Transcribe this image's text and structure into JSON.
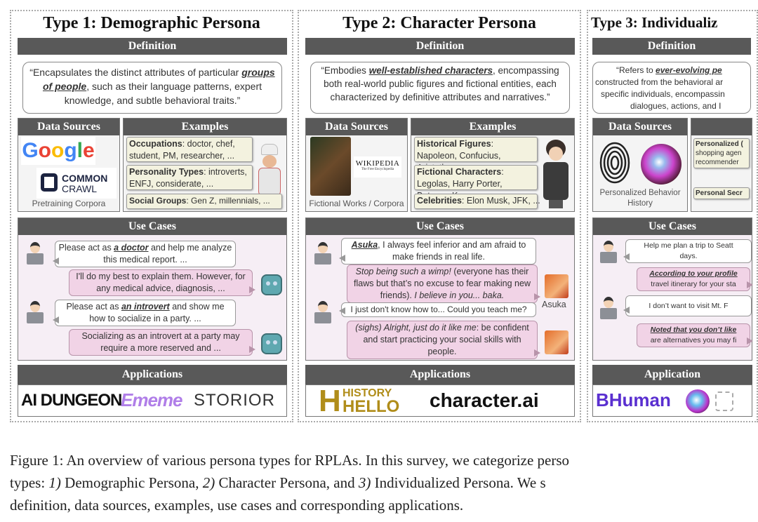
{
  "panels": [
    {
      "title": "Type 1: Demographic Persona",
      "definition_header": "Definition",
      "definition": {
        "pre": "“Encapsulates the distinct attributes of particular ",
        "em": "groups of people",
        "post": ", such as their language patterns, expert knowledge, and subtle behavioral traits.”"
      },
      "data_sources_header": "Data Sources",
      "data_sources_logos": [
        "Google",
        "COMMON",
        "CRAWL"
      ],
      "data_sources_label": "Pretraining Corpora",
      "examples_header": "Examples",
      "examples": [
        {
          "label": "Occupations",
          "text": ": doctor, chef, student, PM, researcher, ..."
        },
        {
          "label": "Personality Types",
          "text": ": introverts, ENFJ, considerate, ..."
        },
        {
          "label": "Social Groups",
          "text": ": Gen Z, millennials, ..."
        }
      ],
      "use_cases_header": "Use Cases",
      "chat": [
        {
          "role": "user",
          "pre": "Please act as ",
          "em": "a doctor",
          "post": " and help me analyze this medical report. ..."
        },
        {
          "role": "bot",
          "text": "I'll do my best to explain them. However, for any medical advice, diagnosis, ..."
        },
        {
          "role": "user",
          "pre": "Please act as ",
          "em": "an introvert",
          "post": " and show me how to socialize in a party. ..."
        },
        {
          "role": "bot",
          "text": "Socializing as an introvert at a party may require a more reserved and ..."
        }
      ],
      "applications_header": "Applications",
      "applications": [
        "AI DUNGEON",
        "Ememe",
        "STORIOR"
      ]
    },
    {
      "title": "Type 2: Character Persona",
      "definition_header": "Definition",
      "definition": {
        "pre": "“Embodies ",
        "em": "well-established characters",
        "post": ", encompassing both real-world public figures and fictional entities, each characterized by definitive attributes and narratives.”"
      },
      "data_sources_header": "Data Sources",
      "data_sources_logos": [
        "WIKIPEDIA",
        "The Free Encyclopedia"
      ],
      "data_sources_label": "Fictional Works / Corpora",
      "examples_header": "Examples",
      "examples": [
        {
          "label": "Historical Figures",
          "text": ": Napoleon, Confucius, Aristotle, ..."
        },
        {
          "label": "Fictional Characters",
          "text": ": Legolas, Harry Porter, Batman, Kong, ..."
        },
        {
          "label": "Celebrities",
          "text": ": Elon Musk, JFK, ..."
        }
      ],
      "use_cases_header": "Use Cases",
      "chat": [
        {
          "role": "user",
          "pre": "",
          "em": "Asuka",
          "post": ", I always feel inferior and am afraid to make friends in real life."
        },
        {
          "role": "bot",
          "it1": "Stop being such a wimp!",
          "mid": " (everyone has their flaws but that’s no excuse to fear making new friends). ",
          "it2": "I believe in you... baka."
        },
        {
          "role": "user",
          "text": "I just don't know how to... Could you teach me?"
        },
        {
          "role": "bot",
          "it1": "(sighs) Alright, just do it like me",
          "mid": ": be confident and start practicing your social skills with people."
        }
      ],
      "bot_name": "Asuka",
      "applications_header": "Applications",
      "applications": [
        "HISTORY",
        "HELLO",
        "character.ai"
      ]
    },
    {
      "title": "Type 3: Individualiz",
      "definition_header": "Definition",
      "definition_lines": [
        {
          "pre": "“Refers to ",
          "em": "ever-evolving pe"
        },
        "constructed from the behavioral ar",
        "specific individuals, encompassin",
        "dialogues, actions, and I"
      ],
      "data_sources_header": "Data Sources",
      "data_sources_label": "Personalized Behavior History",
      "examples": [
        {
          "label": "Personalized (",
          "lines": [
            "shopping agen",
            "recommender"
          ]
        },
        {
          "label": "Personal Secr"
        }
      ],
      "use_cases_header": "Use Cases",
      "chat": [
        {
          "role": "user",
          "lines": [
            "Help me plan a trip to Seatt",
            "days."
          ]
        },
        {
          "role": "bot",
          "em": "According to your profile",
          "line2": "travel itinerary for your sta"
        },
        {
          "role": "user",
          "lines": [
            "I don’t want to visit Mt. F"
          ]
        },
        {
          "role": "bot",
          "em": "Noted that you don’t like",
          "line2": "are alternatives you may fi"
        }
      ],
      "applications_header": "Application",
      "applications": [
        "BHuman"
      ]
    }
  ],
  "caption": {
    "line1": "Figure 1: An overview of various persona types for RPLAs. In this survey, we categorize perso",
    "l2a": "types: ",
    "n1": "1)",
    "l2b": " Demographic Persona, ",
    "n2": "2)",
    "l2c": " Character Persona, and ",
    "n3": "3)",
    "l2d": " Individualized Persona. We s",
    "line3": "definition, data sources, examples, use cases and corresponding applications."
  },
  "colors": {
    "header_bar": "#595959",
    "bot_bubble": "#f1d3e6",
    "example_box": "#f3f2df",
    "use_case_bg": "#f6eef5"
  }
}
